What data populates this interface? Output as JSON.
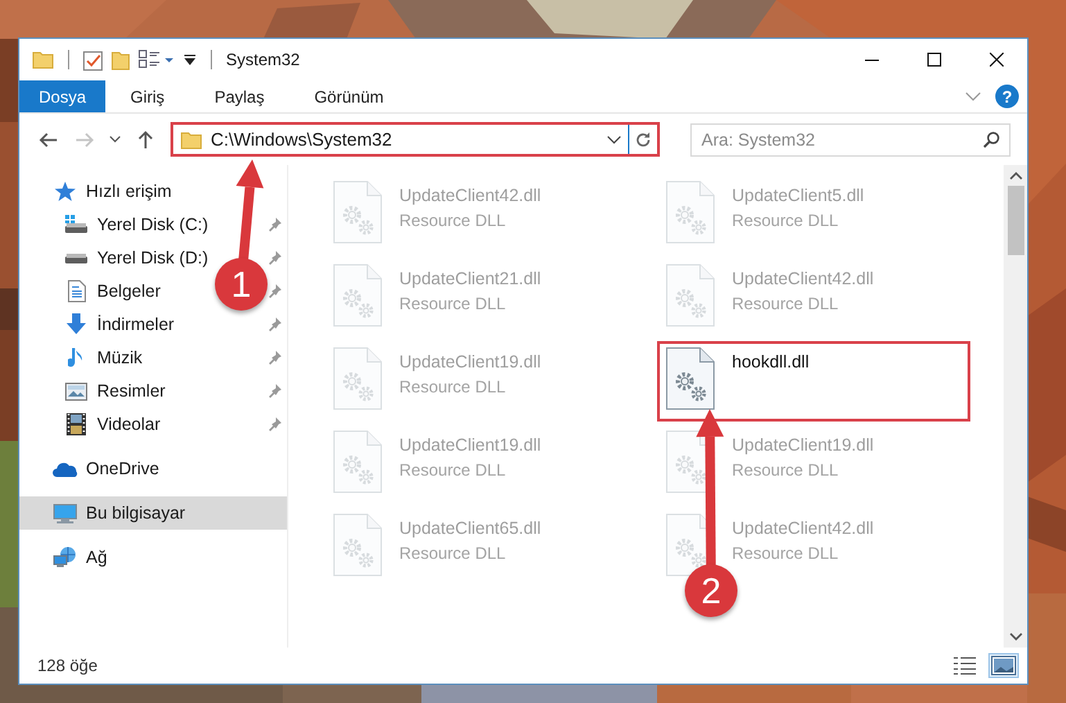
{
  "window": {
    "title": "System32"
  },
  "quick_access_toolbar": [
    {
      "kind": "folder"
    },
    {
      "kind": "properties"
    },
    {
      "kind": "new-folder"
    },
    {
      "kind": "view-menu"
    },
    {
      "kind": "customize"
    }
  ],
  "ribbon_tabs": [
    {
      "label": "Dosya",
      "selected": true
    },
    {
      "label": "Giriş",
      "selected": false
    },
    {
      "label": "Paylaş",
      "selected": false
    },
    {
      "label": "Görünüm",
      "selected": false
    }
  ],
  "help_button": {
    "label": "?"
  },
  "navigation": {
    "back_enabled": true,
    "forward_enabled": false
  },
  "address_bar": {
    "path": "C:\\Windows\\System32",
    "highlighted": true
  },
  "search": {
    "placeholder": "Ara: System32"
  },
  "nav_pane": {
    "items": [
      {
        "label": "Hızlı erişim",
        "kind": "quick-access",
        "selected": false,
        "children": [
          {
            "label": "Yerel Disk (C:)",
            "kind": "system-drive",
            "pinned": true,
            "selected": false
          },
          {
            "label": "Yerel Disk (D:)",
            "kind": "drive",
            "pinned": true,
            "selected": false
          },
          {
            "label": "Belgeler",
            "kind": "documents",
            "pinned": true,
            "selected": false
          },
          {
            "label": "İndirmeler",
            "kind": "downloads",
            "pinned": true,
            "selected": false
          },
          {
            "label": "Müzik",
            "kind": "music",
            "pinned": true,
            "selected": false
          },
          {
            "label": "Resimler",
            "kind": "pictures",
            "pinned": true,
            "selected": false
          },
          {
            "label": "Videolar",
            "kind": "videos",
            "pinned": true,
            "selected": false
          }
        ]
      },
      {
        "label": "OneDrive",
        "kind": "onedrive",
        "selected": false
      },
      {
        "label": "Bu bilgisayar",
        "kind": "computer",
        "selected": true
      },
      {
        "label": "Ağ",
        "kind": "network",
        "selected": false
      }
    ]
  },
  "files": [
    {
      "name": "UpdateClient42.dll",
      "type": "Resource DLL",
      "faded": true,
      "highlighted": false
    },
    {
      "name": "UpdateClient5.dll",
      "type": "Resource DLL",
      "faded": true,
      "highlighted": false
    },
    {
      "name": "UpdateClient21.dll",
      "type": "Resource DLL",
      "faded": true,
      "highlighted": false
    },
    {
      "name": "UpdateClient42.dll",
      "type": "Resource DLL",
      "faded": true,
      "highlighted": false
    },
    {
      "name": "UpdateClient19.dll",
      "type": "Resource DLL",
      "faded": true,
      "highlighted": false
    },
    {
      "name": "hookdll.dll",
      "faded": false,
      "highlighted": true
    },
    {
      "name": "UpdateClient19.dll",
      "type": "Resource DLL",
      "faded": true,
      "highlighted": false
    },
    {
      "name": "UpdateClient19.dll",
      "type": "Resource DLL",
      "faded": true,
      "highlighted": false
    },
    {
      "name": "UpdateClient65.dll",
      "type": "Resource DLL",
      "faded": true,
      "highlighted": false
    },
    {
      "name": "UpdateClient42.dll",
      "type": "Resource DLL",
      "faded": true,
      "highlighted": false
    }
  ],
  "status_bar": {
    "item_count": "128 öğe"
  },
  "view_buttons": [
    {
      "kind": "details",
      "selected": false
    },
    {
      "kind": "large-icons",
      "selected": true
    }
  ],
  "annotations": [
    {
      "number": "1"
    },
    {
      "number": "2"
    }
  ]
}
